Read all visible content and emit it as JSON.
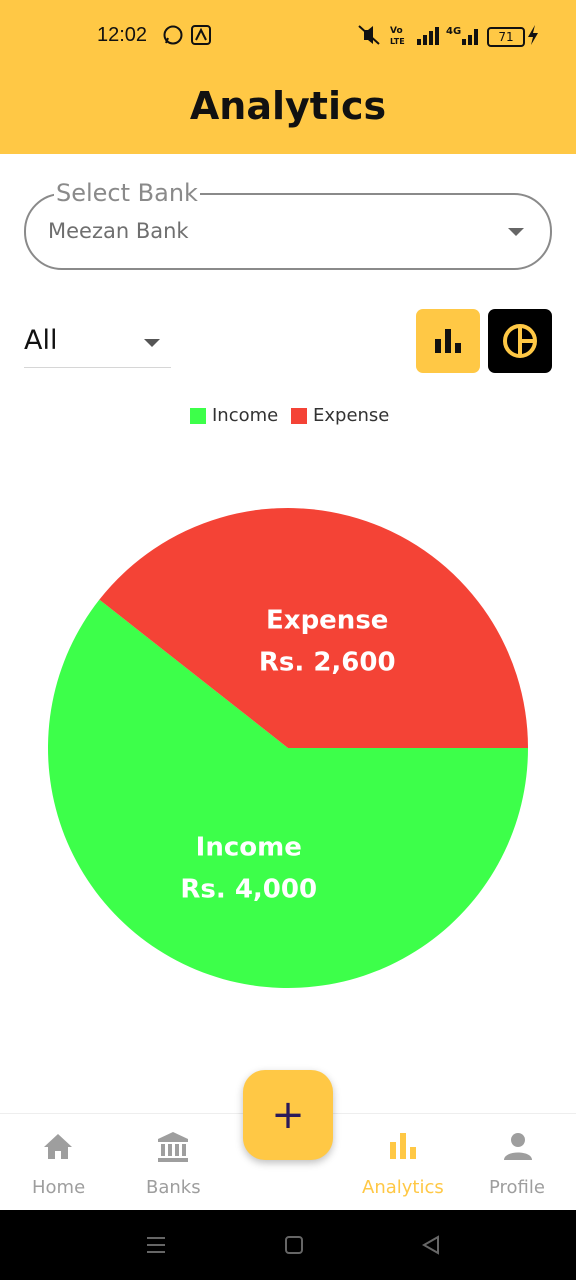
{
  "status_bar": {
    "time": "12:02",
    "battery": "71",
    "network": "4G"
  },
  "header": {
    "title": "Analytics"
  },
  "bank_select": {
    "label": "Select Bank",
    "value": "Meezan Bank"
  },
  "filter": {
    "value": "All"
  },
  "chart_toggle": {
    "options": [
      "bar-chart",
      "pie-chart"
    ],
    "selected": "pie-chart"
  },
  "colors": {
    "accent": "#FFC845",
    "income": "#3DFF4A",
    "expense": "#F44336",
    "inactive": "#9E9E9E"
  },
  "chart_data": {
    "type": "pie",
    "legend": [
      "Income",
      "Expense"
    ],
    "legend_position": "top-center",
    "slices": [
      {
        "name": "Income",
        "value": 4000,
        "label": "Rs. 4,000",
        "color": "#3DFF4A"
      },
      {
        "name": "Expense",
        "value": 2600,
        "label": "Rs. 2,600",
        "color": "#F44336"
      }
    ]
  },
  "fab": {
    "label": "+"
  },
  "bottom_nav": {
    "items": [
      {
        "label": "Home",
        "icon": "home-icon"
      },
      {
        "label": "Banks",
        "icon": "bank-icon"
      },
      {
        "label": "Analytics",
        "icon": "bar-chart-icon",
        "active": true
      },
      {
        "label": "Profile",
        "icon": "person-icon"
      }
    ]
  }
}
